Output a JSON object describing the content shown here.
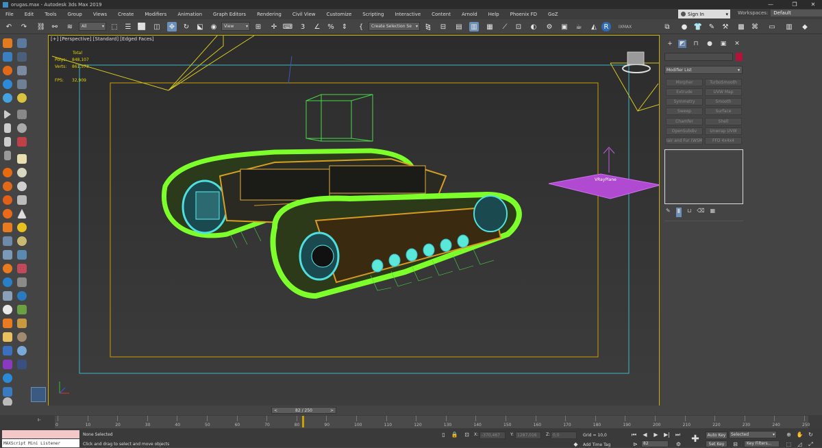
{
  "window": {
    "title": "orugas.max - Autodesk 3ds Max 2019",
    "min_icon": "minimize-icon",
    "max_icon": "restore-icon",
    "close_icon": "close-icon"
  },
  "menu": [
    "File",
    "Edit",
    "Tools",
    "Group",
    "Views",
    "Create",
    "Modifiers",
    "Animation",
    "Graph Editors",
    "Rendering",
    "Civil View",
    "Customize",
    "Scripting",
    "Interactive",
    "Content",
    "Arnold",
    "Help",
    "Phoenix FD",
    "GoZ"
  ],
  "signin": {
    "label": "Sign In"
  },
  "workspaces": {
    "label": "Workspaces:",
    "value": "Default"
  },
  "toolbar": {
    "filter_value": "All",
    "refcoord_value": "View",
    "selection_set_placeholder": "Create Selection Se",
    "ixmax_label": "IXMAX"
  },
  "viewport": {
    "label": "[+] [Perspective] [Standard] [Edged Faces]",
    "stats": {
      "total_label": "Total",
      "polys_label": "Polys:",
      "polys_value": "848,107",
      "verts_label": "Verts:",
      "verts_value": "861,573",
      "fps_label": "FPS:",
      "fps_value": "32,909"
    },
    "plane_label": "VRayPlane"
  },
  "command_panel": {
    "modifier_list_label": "Modifier List",
    "modifier_buttons": [
      [
        "Morpher",
        "TurboSmooth"
      ],
      [
        "Extrude",
        "UVW Map"
      ],
      [
        "Symmetry",
        "Smooth"
      ],
      [
        "Sweep",
        "Surface"
      ],
      [
        "Chamfer",
        "Shell"
      ],
      [
        "OpenSubdiv",
        "Unwrap UVW"
      ],
      [
        "Hair and Fur (WSM)",
        "FFD 4x4x4"
      ]
    ]
  },
  "timeline": {
    "slider_text": "82 / 250",
    "slider_left": "<",
    "slider_right": ">",
    "current_frame": 82,
    "total_frames": 250,
    "ticks": [
      "0",
      "10",
      "20",
      "30",
      "40",
      "50",
      "60",
      "70",
      "80",
      "90",
      "100",
      "110",
      "120",
      "130",
      "140",
      "150",
      "160",
      "170",
      "180",
      "190",
      "200",
      "210",
      "220",
      "230",
      "240",
      "250"
    ]
  },
  "status": {
    "listener_label": "MAXScript Mini Listener",
    "selection_text": "None Selected",
    "prompt_text": "Click and drag to select and move objects",
    "x_label": "X:",
    "x_value": "-370,467",
    "y_label": "Y:",
    "y_value": "1287,016",
    "z_label": "Z:",
    "z_value": "0,0",
    "grid_text": "Grid = 10,0",
    "add_time_tag": "Add Time Tag",
    "frame_value": "82",
    "auto_key": "Auto Key",
    "set_key": "Set Key",
    "selected_value": "Selected",
    "key_filters": "Key Filters..."
  }
}
